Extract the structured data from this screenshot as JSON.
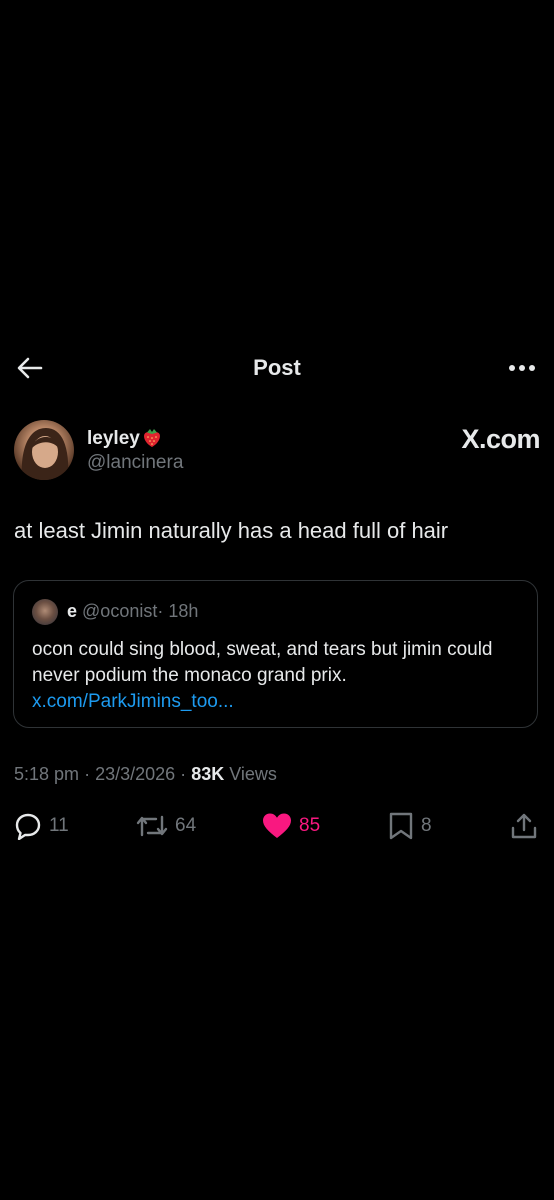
{
  "header": {
    "title": "Post"
  },
  "author": {
    "display_name": "leyley",
    "emoji": "strawberry",
    "handle": "@lancinera"
  },
  "watermark": "X.com",
  "post": {
    "text": "at least Jimin naturally has a head full of hair"
  },
  "quote": {
    "name": "e",
    "handle": "@oconist",
    "separator": "·",
    "age": "18h",
    "text": "ocon could sing blood, sweat, and tears but jimin could never podium the monaco grand prix. ",
    "link": "x.com/ParkJimins_too..."
  },
  "meta": {
    "time": "5:18 pm",
    "separator": "·",
    "date": "23/3/2026",
    "views_count": "83K",
    "views_label": "Views"
  },
  "actions": {
    "replies": "11",
    "reposts": "64",
    "likes": "85",
    "bookmarks": "8"
  },
  "colors": {
    "background": "#000000",
    "primary_text": "#e7e9ea",
    "secondary_text": "#71767b",
    "link": "#1d9bf0",
    "like": "#f91880",
    "border": "#2f3336"
  },
  "icons": [
    "back-arrow-icon",
    "more-icon",
    "strawberry-icon",
    "reply-icon",
    "repost-icon",
    "heart-icon",
    "bookmark-icon",
    "share-icon"
  ]
}
